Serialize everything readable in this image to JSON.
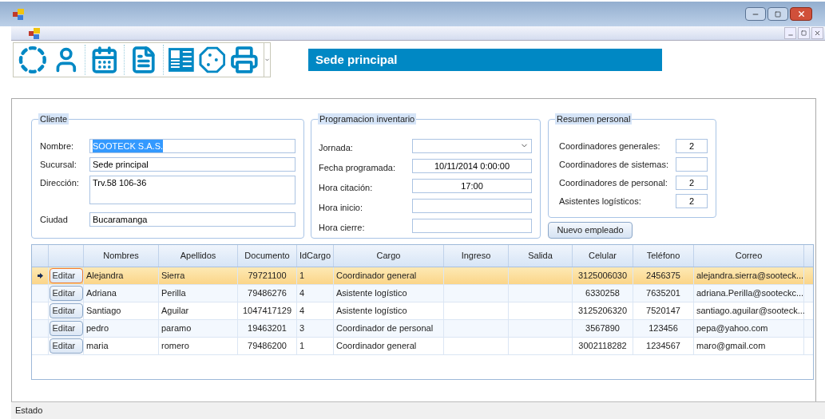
{
  "banner": "Sede principal",
  "cliente": {
    "title": "Cliente",
    "fields": [
      {
        "label": "Nombre:",
        "value": "SOOTECK S.A.S.",
        "kind": "text",
        "highlighted": true
      },
      {
        "label": "Sucursal:",
        "value": "Sede principal",
        "kind": "text",
        "highlighted": false
      },
      {
        "label": "Dirección:",
        "value": "Trv.58 106-36",
        "kind": "multiline",
        "highlighted": false
      },
      {
        "label": "Ciudad",
        "value": "Bucaramanga",
        "kind": "text",
        "highlighted": false
      }
    ]
  },
  "programacion": {
    "title": "Programacion inventario",
    "fields": [
      {
        "label": "Jornada:",
        "kind": "combo"
      },
      {
        "label": "Fecha programada:",
        "value": "10/11/2014 0:00:00",
        "kind": "text"
      },
      {
        "label": "Hora citación:",
        "value": "17:00",
        "kind": "text"
      },
      {
        "label": "Hora inicio:",
        "kind": "text"
      },
      {
        "label": "Hora cierre:",
        "kind": "text"
      }
    ]
  },
  "resumen": {
    "title": "Resumen personal",
    "fields": [
      {
        "label": "Coordinadores generales:",
        "value": "2"
      },
      {
        "label": "Coordinadores de sistemas:"
      },
      {
        "label": "Coordinadores de personal:",
        "value": "2"
      },
      {
        "label": "Asistentes logísticos:",
        "value": "2"
      }
    ]
  },
  "new_button": "Nuevo empleado",
  "table": {
    "columns": [
      "Nombres",
      "Apellidos",
      "Documento",
      "IdCargo",
      "Cargo",
      "Ingreso",
      "Salida",
      "Celular",
      "Teléfono",
      "Correo"
    ],
    "rows": [
      {
        "selected": true,
        "button": "Editar",
        "cells": [
          "Alejandra",
          "Sierra",
          "79721100",
          "1",
          "Coordinador general",
          "",
          "",
          "3125006030",
          "2456375",
          "alejandra.sierra@sooteck..."
        ]
      },
      {
        "selected": false,
        "button": "Editar",
        "cells": [
          "Adriana",
          "Perilla",
          "79486276",
          "4",
          "Asistente logístico",
          "",
          "",
          "6330258",
          "7635201",
          "adriana.Perilla@sooteckc..."
        ]
      },
      {
        "selected": false,
        "button": "Editar",
        "cells": [
          "Santiago",
          "Aguilar",
          "1047417129",
          "4",
          "Asistente logístico",
          "",
          "",
          "3125206320",
          "7520147",
          "santiago.aguilar@sooteck..."
        ]
      },
      {
        "selected": false,
        "button": "Editar",
        "cells": [
          "pedro",
          "paramo",
          "19463201",
          "3",
          "Coordinador de personal",
          "",
          "",
          "3567890",
          "123456",
          "pepa@yahoo.com"
        ]
      },
      {
        "selected": false,
        "button": "Editar",
        "cells": [
          "maria",
          "romero",
          "79486200",
          "1",
          "Coordinador general",
          "",
          "",
          "3002118282",
          "1234567",
          "maro@gmail.com"
        ]
      }
    ]
  },
  "status_bar": "Estado"
}
